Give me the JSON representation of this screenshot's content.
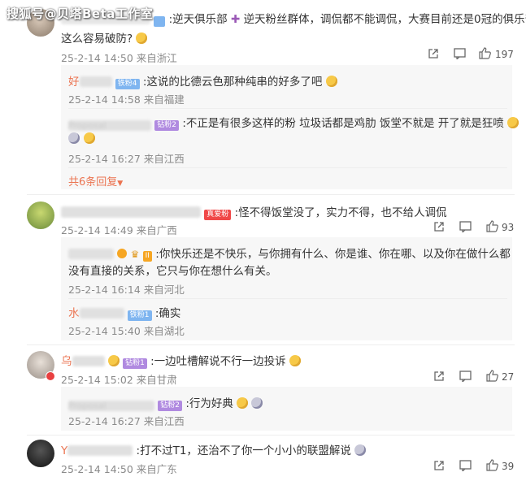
{
  "watermark": "搜狐号@贝塔Beta工作室",
  "comments": [
    {
      "text_line1": ":逆天俱乐部",
      "text_line1b": "逆天粉丝群体，调侃都不能调侃，大赛目前还是0冠的俱乐部",
      "text_line2": "这么容易破防?",
      "date": "25-2-14 14:50",
      "loc": "来自浙江",
      "likes": "197",
      "replies": [
        {
          "user": "好",
          "badge": "铁粉4",
          "text": ":这说的比德云色那种纯串的好多了吧",
          "date": "25-2-14 14:58",
          "loc": "来自福建"
        },
        {
          "user": "Proposal",
          "badge": "钻粉2",
          "text": ":不正是有很多这样的粉 垃圾话都是鸡肋 饭堂不就是 开了就是狂喷",
          "date": "25-2-14 16:27",
          "loc": "来自江西"
        }
      ],
      "more": "共6条回复"
    },
    {
      "badge": "真爱粉",
      "text": ":怪不得饭堂没了，实力不得，也不给人调侃",
      "date": "25-2-14 14:49",
      "loc": "来自广西",
      "likes": "93",
      "replies": [
        {
          "badge": "II",
          "text_line1": ":你快乐还是不快乐，与你拥有什么、你是谁、你在哪、以及你在做什么都",
          "text_line2": "没有直接的关系，它只与你在想什么有关。",
          "date": "25-2-14 16:14",
          "loc": "来自河北"
        },
        {
          "user": "水",
          "badge": "铁粉1",
          "text": ":确实",
          "date": "25-2-14 15:40",
          "loc": "来自湖北"
        }
      ]
    },
    {
      "user": "乌",
      "badge": "钻粉1",
      "text": ":一边吐槽解说不行一边投诉",
      "date": "25-2-14 15:02",
      "loc": "来自甘肃",
      "likes": "27",
      "replies": [
        {
          "user": "Proposal",
          "badge": "钻粉2",
          "text": ":行为好典",
          "date": "25-2-14 16:27",
          "loc": "来自江西"
        }
      ]
    },
    {
      "user": "Y",
      "text": ":打不过T1，还治不了你一个小小的联盟解说",
      "date": "25-2-14 14:50",
      "loc": "来自广东",
      "likes": "39"
    }
  ],
  "icons": {
    "share": "share-icon",
    "comment": "comment-icon",
    "like": "like-icon"
  },
  "colors": {
    "meta": "#8a8a8a",
    "more_link": "#eb7350",
    "badge_blue": "#7fb5f0",
    "badge_purple": "#b08ae0"
  }
}
